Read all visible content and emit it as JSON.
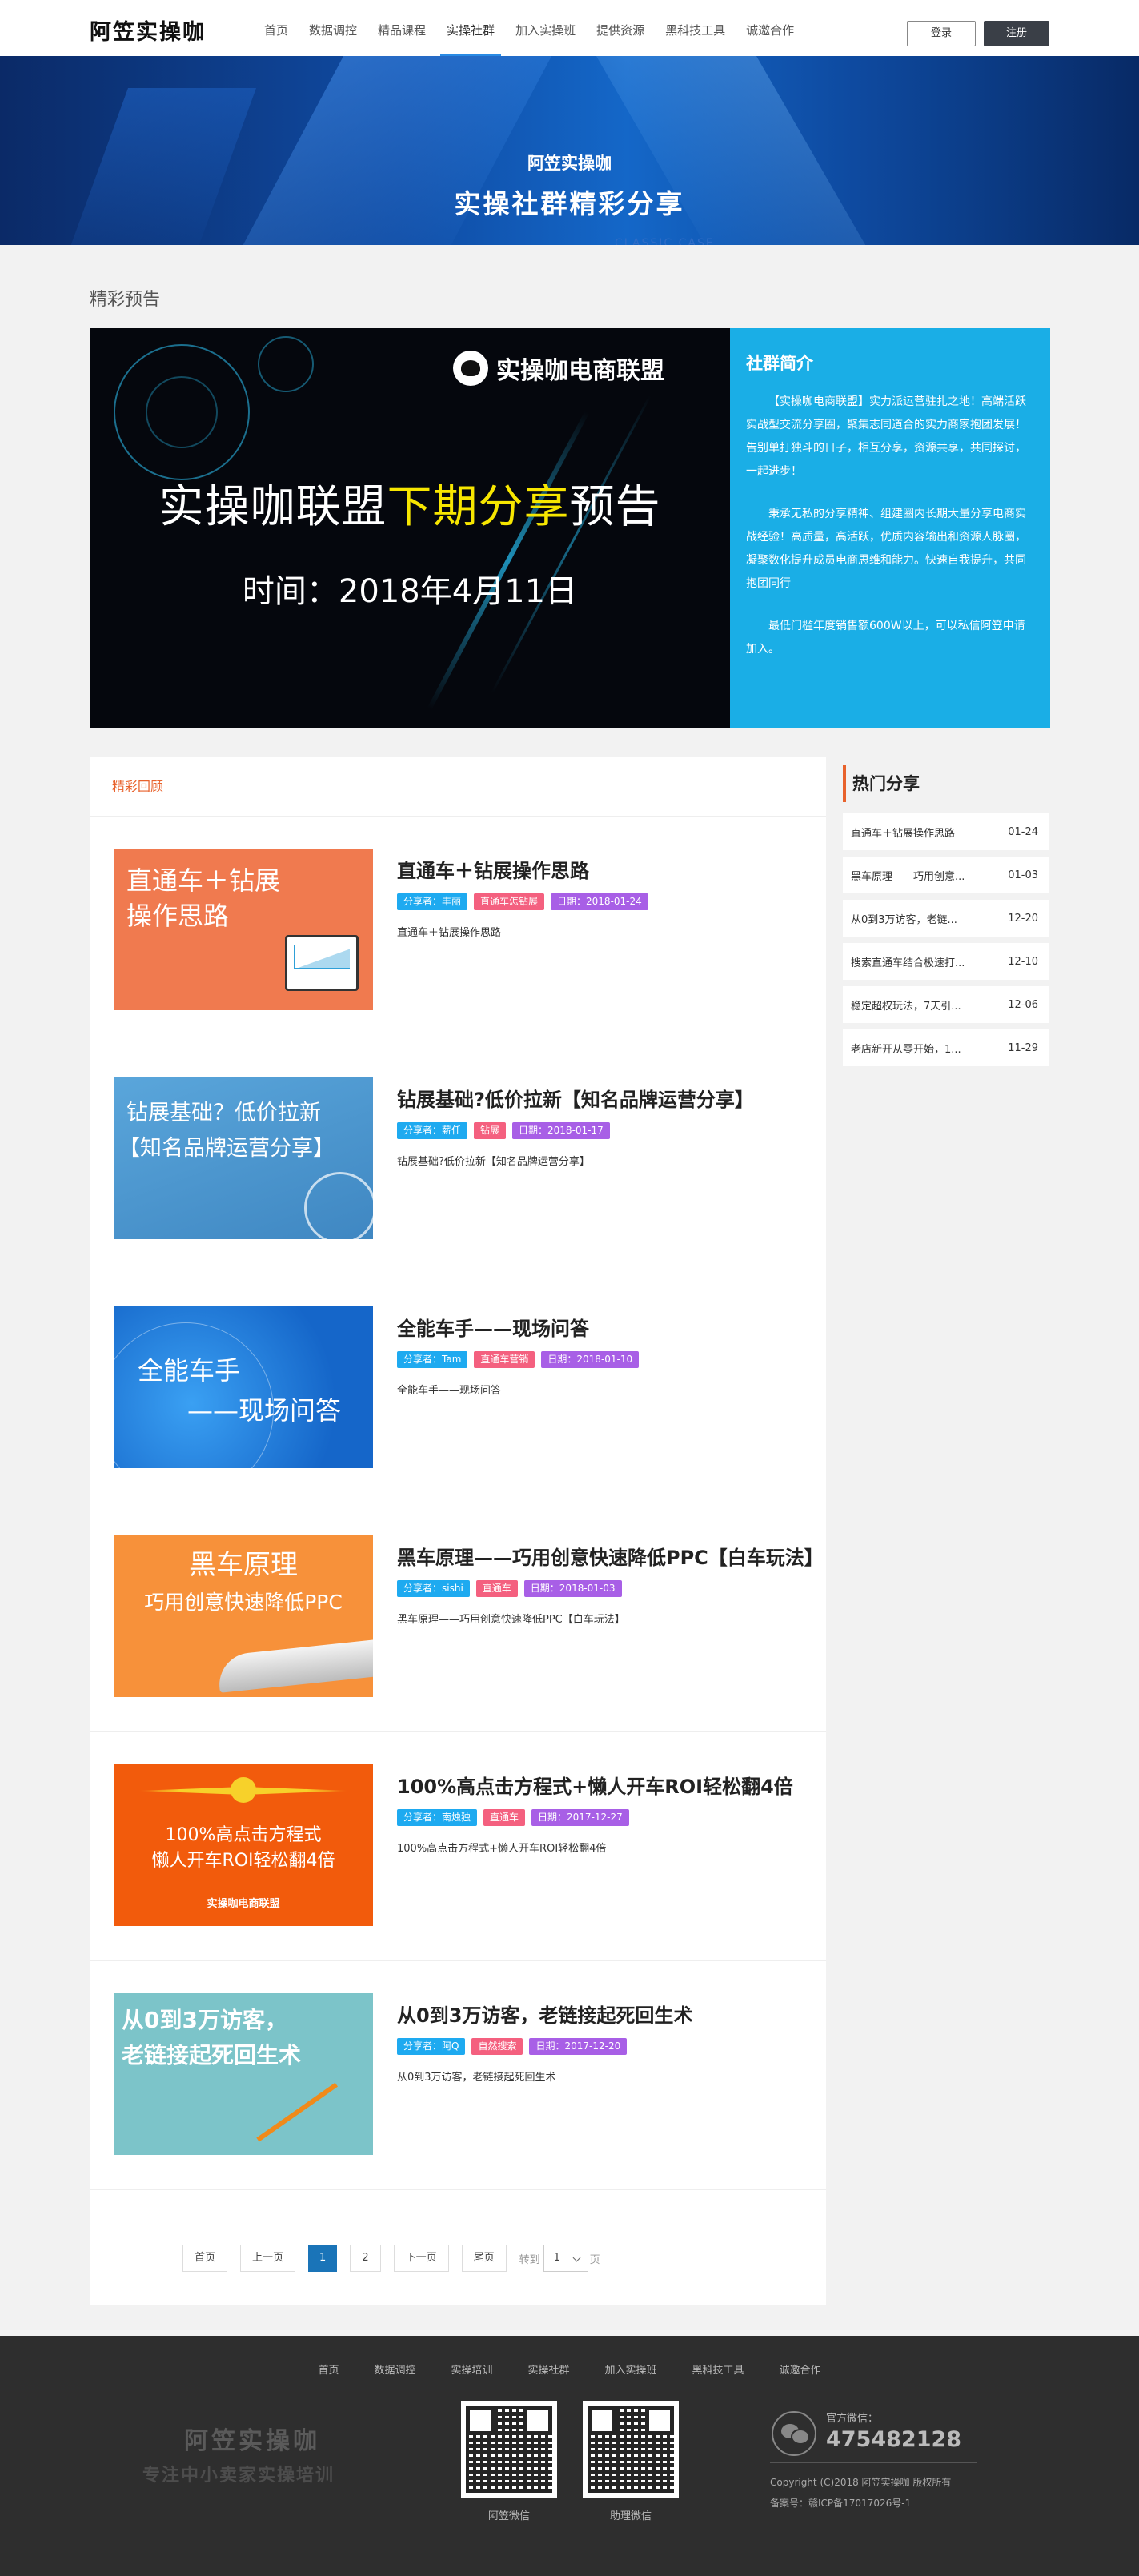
{
  "header": {
    "logo": "阿笠实操咖",
    "nav": [
      "首页",
      "数据调控",
      "精品课程",
      "实操社群",
      "加入实操班",
      "提供资源",
      "黑科技工具",
      "诚邀合作"
    ],
    "login": "登录",
    "register": "注册",
    "active_nav": "实操社群"
  },
  "banner": {
    "subtitle": "阿笠实操咖",
    "title": "实操社群精彩分享",
    "en": "CLASSIC CASE"
  },
  "preview": {
    "section_title": "精彩预告",
    "brand": "实操咖电商联盟",
    "headline_a": "实操咖联盟",
    "headline_hl": "下期分享",
    "headline_b": "预告",
    "date_line": "时间：2018年4月11日"
  },
  "intro": {
    "title": "社群简介",
    "p1": "【实操咖电商联盟】实力派运营驻扎之地！高端活跃实战型交流分享圈，聚集志同道合的实力商家抱团发展！告别单打独斗的日子，相互分享，资源共享，共同探讨，一起进步！",
    "p2": "秉承无私的分享精神、组建圈内长期大量分享电商实战经验！高质量，高活跃，优质内容输出和资源人脉圈，凝聚数化提升成员电商思维和能力。快速自我提升，共同抱团同行",
    "p3": "最低门槛年度销售额600W以上，可以私信阿笠申请加入。"
  },
  "review": {
    "title": "精彩回顾",
    "articles": [
      {
        "title": "直通车＋钻展操作思路",
        "author": "分享者：丰丽",
        "tag": "直通车怎钻展",
        "date": "日期：2018-01-24",
        "desc": "直通车＋钻展操作思路",
        "thumb_a": "直通车＋钻展",
        "thumb_b": "操作思路",
        "thumb_color": "#f07a4f"
      },
      {
        "title": "钻展基础?低价拉新【知名品牌运营分享】",
        "author": "分享者：薪任",
        "tag": "钻展",
        "date": "日期：2018-01-17",
        "desc": "钻展基础?低价拉新【知名品牌运营分享】",
        "thumb_a": "钻展基础？低价拉新",
        "thumb_b": "【知名品牌运营分享】",
        "thumb_color": "#4f9bd3"
      },
      {
        "title": "全能车手——现场问答",
        "author": "分享者：Tam",
        "tag": "直通车营销",
        "date": "日期：2018-01-10",
        "desc": "全能车手——现场问答",
        "thumb_a": "全能车手",
        "thumb_b": "——现场问答",
        "thumb_color": "#1f7fe0"
      },
      {
        "title": "黑车原理——巧用创意快速降低PPC【白车玩法】",
        "author": "分享者：sishi",
        "tag": "直通车",
        "date": "日期：2018-01-03",
        "desc": "黑车原理——巧用创意快速降低PPC【白车玩法】",
        "thumb_a": "黑车原理",
        "thumb_b": "巧用创意快速降低PPC",
        "thumb_color": "#f7913a"
      },
      {
        "title": "100%高点击方程式+懒人开车ROI轻松翻4倍",
        "author": "分享者：南烛独",
        "tag": "直通车",
        "date": "日期：2017-12-27",
        "desc": "100%高点击方程式+懒人开车ROI轻松翻4倍",
        "thumb_a": "100%高点击方程式",
        "thumb_b": "懒人开车ROI轻松翻4倍",
        "thumb_color": "#f25b0c"
      },
      {
        "title": "从0到3万访客，老链接起死回生术",
        "author": "分享者：阿Q",
        "tag": "自然搜索",
        "date": "日期：2017-12-20",
        "desc": "从0到3万访客，老链接起死回生术",
        "thumb_a": "从0到3万访客，",
        "thumb_b": "老链接起死回生术",
        "thumb_color": "#7cc4c9"
      }
    ],
    "thumb_brand": "实操咖电商联盟"
  },
  "pagination": {
    "first": "首页",
    "prev": "上一页",
    "current": "1",
    "page2": "2",
    "next": "下一页",
    "last": "尾页",
    "goto": "转到",
    "select_value": "1",
    "unit": "页"
  },
  "hot": {
    "title": "热门分享",
    "items": [
      {
        "t": "直通车＋钻展操作思路",
        "d": "01-24"
      },
      {
        "t": "黑车原理——巧用创意...",
        "d": "01-03"
      },
      {
        "t": "从0到3万访客，老链...",
        "d": "12-20"
      },
      {
        "t": "搜索直通车结合极速打...",
        "d": "12-10"
      },
      {
        "t": "稳定超权玩法，7天引...",
        "d": "12-06"
      },
      {
        "t": "老店新开从零开始，1...",
        "d": "11-29"
      }
    ]
  },
  "footer": {
    "nav": [
      "首页",
      "数据调控",
      "实操培训",
      "实操社群",
      "加入实操班",
      "黑科技工具",
      "诚邀合作"
    ],
    "logo": "阿笠实操咖",
    "slogan": "专注中小卖家实操培训",
    "qr1": "阿笠微信",
    "qr2": "助理微信",
    "wx_label": "官方微信：",
    "wx_num": "475482128",
    "copyright": "Copyright (C)2018 阿笠实操咖 版权所有",
    "icp": "备案号：赣ICP备17017026号-1"
  }
}
